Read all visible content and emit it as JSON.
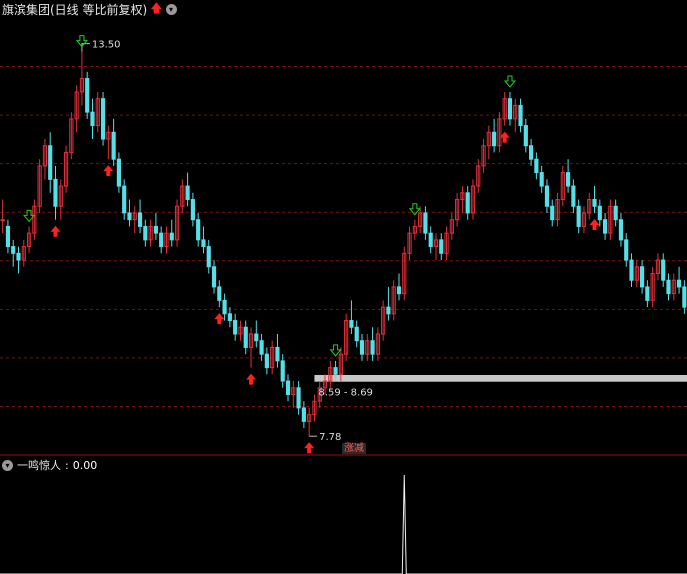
{
  "header": {
    "title": "旗滨集团(日线 等比前复权)",
    "arrow_icon": "red-up-arrow-icon",
    "menu_icon": "chevron-down-icon"
  },
  "footer_tag": "涨减",
  "subchart": {
    "label": "一鸣惊人",
    "separator": " : ",
    "value": "0.00"
  },
  "annotations": {
    "high_label": "13.50",
    "low_label": "7.78",
    "range_label": "8.59 - 8.69"
  },
  "colors": {
    "background": "#000000",
    "up_candle": "#e0313a",
    "down_candle": "#55e0e8",
    "grid": "#7a1010",
    "buy_arrow": "#ff2020",
    "sell_arrow": "#20d020",
    "range_band": "#c8c8c8",
    "indicator_line": "#f0f0f0"
  },
  "chart_data": [
    {
      "type": "candlestick",
      "title": "旗滨集团(日线 等比前复权)",
      "ylim": [
        7.5,
        14.0
      ],
      "grid": true,
      "series": [
        {
          "name": "旗滨集团",
          "ohlc": [
            [
              11.0,
              11.3,
              10.8,
              11.0
            ],
            [
              10.9,
              11.0,
              10.5,
              10.6
            ],
            [
              10.6,
              10.7,
              10.3,
              10.5
            ],
            [
              10.5,
              10.6,
              10.2,
              10.4
            ],
            [
              10.4,
              10.7,
              10.3,
              10.6
            ],
            [
              10.6,
              10.9,
              10.5,
              10.8
            ],
            [
              10.8,
              11.3,
              10.7,
              11.2
            ],
            [
              11.2,
              11.9,
              11.1,
              11.8
            ],
            [
              11.8,
              12.2,
              11.6,
              12.1
            ],
            [
              12.1,
              12.3,
              11.4,
              11.6
            ],
            [
              11.6,
              11.8,
              11.0,
              11.2
            ],
            [
              11.2,
              11.6,
              11.0,
              11.5
            ],
            [
              11.5,
              12.1,
              11.4,
              12.0
            ],
            [
              12.0,
              12.6,
              11.9,
              12.5
            ],
            [
              12.5,
              13.0,
              12.3,
              12.9
            ],
            [
              12.9,
              13.5,
              12.7,
              13.1
            ],
            [
              13.1,
              13.2,
              12.5,
              12.6
            ],
            [
              12.6,
              12.8,
              12.2,
              12.4
            ],
            [
              12.4,
              12.9,
              12.3,
              12.8
            ],
            [
              12.8,
              12.9,
              12.1,
              12.2
            ],
            [
              12.2,
              12.4,
              11.9,
              12.3
            ],
            [
              12.3,
              12.5,
              11.8,
              11.9
            ],
            [
              11.9,
              12.0,
              11.4,
              11.5
            ],
            [
              11.5,
              11.6,
              11.0,
              11.1
            ],
            [
              11.1,
              11.3,
              10.9,
              11.0
            ],
            [
              11.0,
              11.2,
              10.8,
              11.1
            ],
            [
              11.1,
              11.3,
              10.8,
              10.9
            ],
            [
              10.9,
              11.0,
              10.6,
              10.7
            ],
            [
              10.7,
              11.0,
              10.6,
              10.9
            ],
            [
              10.9,
              11.1,
              10.7,
              10.8
            ],
            [
              10.8,
              10.9,
              10.5,
              10.6
            ],
            [
              10.6,
              10.9,
              10.5,
              10.8
            ],
            [
              10.8,
              11.0,
              10.6,
              10.7
            ],
            [
              10.7,
              11.3,
              10.6,
              11.2
            ],
            [
              11.2,
              11.6,
              11.1,
              11.5
            ],
            [
              11.5,
              11.7,
              11.2,
              11.3
            ],
            [
              11.3,
              11.4,
              10.9,
              11.0
            ],
            [
              11.0,
              11.1,
              10.6,
              10.7
            ],
            [
              10.7,
              10.9,
              10.5,
              10.6
            ],
            [
              10.6,
              10.7,
              10.2,
              10.3
            ],
            [
              10.3,
              10.4,
              9.9,
              10.0
            ],
            [
              10.0,
              10.1,
              9.7,
              9.8
            ],
            [
              9.8,
              9.9,
              9.5,
              9.6
            ],
            [
              9.6,
              9.7,
              9.4,
              9.5
            ],
            [
              9.5,
              9.6,
              9.2,
              9.3
            ],
            [
              9.3,
              9.5,
              9.2,
              9.4
            ],
            [
              9.4,
              9.5,
              9.0,
              9.1
            ],
            [
              9.1,
              9.4,
              8.8,
              9.3
            ],
            [
              9.3,
              9.5,
              9.1,
              9.2
            ],
            [
              9.2,
              9.3,
              8.9,
              9.0
            ],
            [
              9.0,
              9.1,
              8.7,
              8.8
            ],
            [
              8.8,
              9.2,
              8.7,
              9.1
            ],
            [
              9.1,
              9.3,
              8.8,
              8.9
            ],
            [
              8.9,
              9.0,
              8.5,
              8.6
            ],
            [
              8.6,
              8.7,
              8.3,
              8.4
            ],
            [
              8.4,
              8.6,
              8.2,
              8.5
            ],
            [
              8.5,
              8.6,
              8.1,
              8.2
            ],
            [
              8.2,
              8.3,
              7.9,
              8.0
            ],
            [
              8.0,
              8.2,
              7.78,
              8.1
            ],
            [
              8.1,
              8.4,
              8.0,
              8.3
            ],
            [
              8.3,
              8.6,
              8.2,
              8.5
            ],
            [
              8.5,
              8.7,
              8.4,
              8.6
            ],
            [
              8.6,
              8.9,
              8.5,
              8.8
            ],
            [
              8.8,
              8.9,
              8.6,
              8.7
            ],
            [
              8.7,
              9.1,
              8.6,
              9.0
            ],
            [
              9.0,
              9.6,
              8.9,
              9.5
            ],
            [
              9.5,
              9.8,
              9.3,
              9.4
            ],
            [
              9.4,
              9.5,
              9.1,
              9.2
            ],
            [
              9.2,
              9.3,
              8.9,
              9.0
            ],
            [
              9.0,
              9.3,
              8.9,
              9.2
            ],
            [
              9.2,
              9.4,
              8.9,
              9.0
            ],
            [
              9.0,
              9.4,
              8.9,
              9.3
            ],
            [
              9.3,
              9.8,
              9.2,
              9.7
            ],
            [
              9.7,
              10.0,
              9.5,
              9.6
            ],
            [
              9.6,
              10.1,
              9.5,
              10.0
            ],
            [
              10.0,
              10.2,
              9.8,
              9.9
            ],
            [
              9.9,
              10.6,
              9.8,
              10.5
            ],
            [
              10.5,
              10.9,
              10.4,
              10.8
            ],
            [
              10.8,
              11.0,
              10.7,
              10.9
            ],
            [
              10.9,
              11.2,
              10.8,
              11.1
            ],
            [
              11.1,
              11.2,
              10.7,
              10.8
            ],
            [
              10.8,
              10.9,
              10.5,
              10.6
            ],
            [
              10.6,
              10.8,
              10.4,
              10.7
            ],
            [
              10.7,
              10.8,
              10.4,
              10.5
            ],
            [
              10.5,
              10.9,
              10.4,
              10.8
            ],
            [
              10.8,
              11.1,
              10.7,
              11.0
            ],
            [
              11.0,
              11.4,
              10.9,
              11.3
            ],
            [
              11.3,
              11.5,
              11.1,
              11.4
            ],
            [
              11.4,
              11.5,
              11.0,
              11.1
            ],
            [
              11.1,
              11.6,
              11.0,
              11.5
            ],
            [
              11.5,
              11.9,
              11.4,
              11.8
            ],
            [
              11.8,
              12.2,
              11.7,
              12.1
            ],
            [
              12.1,
              12.4,
              11.9,
              12.3
            ],
            [
              12.3,
              12.5,
              12.0,
              12.1
            ],
            [
              12.1,
              12.6,
              12.0,
              12.5
            ],
            [
              12.5,
              12.9,
              12.4,
              12.8
            ],
            [
              12.8,
              12.9,
              12.4,
              12.5
            ],
            [
              12.5,
              12.8,
              12.3,
              12.7
            ],
            [
              12.7,
              12.8,
              12.3,
              12.4
            ],
            [
              12.4,
              12.5,
              12.0,
              12.1
            ],
            [
              12.1,
              12.2,
              11.8,
              11.9
            ],
            [
              11.9,
              12.0,
              11.6,
              11.7
            ],
            [
              11.7,
              11.8,
              11.4,
              11.5
            ],
            [
              11.5,
              11.6,
              11.1,
              11.2
            ],
            [
              11.2,
              11.3,
              10.9,
              11.0
            ],
            [
              11.0,
              11.4,
              10.9,
              11.3
            ],
            [
              11.3,
              11.8,
              11.2,
              11.7
            ],
            [
              11.7,
              11.9,
              11.4,
              11.5
            ],
            [
              11.5,
              11.6,
              11.1,
              11.2
            ],
            [
              11.2,
              11.3,
              10.8,
              10.9
            ],
            [
              10.9,
              11.2,
              10.8,
              11.1
            ],
            [
              11.1,
              11.4,
              11.0,
              11.3
            ],
            [
              11.3,
              11.5,
              11.1,
              11.2
            ],
            [
              11.2,
              11.3,
              10.9,
              11.0
            ],
            [
              11.0,
              11.1,
              10.7,
              10.8
            ],
            [
              10.8,
              11.3,
              10.7,
              11.2
            ],
            [
              11.2,
              11.3,
              10.9,
              11.0
            ],
            [
              11.0,
              11.1,
              10.6,
              10.7
            ],
            [
              10.7,
              10.8,
              10.3,
              10.4
            ],
            [
              10.4,
              10.5,
              10.0,
              10.1
            ],
            [
              10.1,
              10.4,
              10.0,
              10.3
            ],
            [
              10.3,
              10.4,
              9.9,
              10.0
            ],
            [
              10.0,
              10.1,
              9.7,
              9.8
            ],
            [
              9.8,
              10.3,
              9.7,
              10.2
            ],
            [
              10.2,
              10.5,
              10.1,
              10.4
            ],
            [
              10.4,
              10.5,
              10.0,
              10.1
            ],
            [
              10.1,
              10.2,
              9.8,
              9.9
            ],
            [
              9.9,
              10.2,
              9.8,
              10.1
            ],
            [
              10.1,
              10.3,
              9.9,
              10.0
            ],
            [
              10.0,
              10.1,
              9.6,
              9.7
            ]
          ]
        }
      ]
    },
    {
      "type": "line",
      "title": "一鸣惊人",
      "ylim": [
        0,
        1
      ],
      "series": [
        {
          "name": "一鸣惊人",
          "spike_at_index": 76,
          "baseline": 0.0,
          "spike": 1.0
        }
      ]
    }
  ]
}
